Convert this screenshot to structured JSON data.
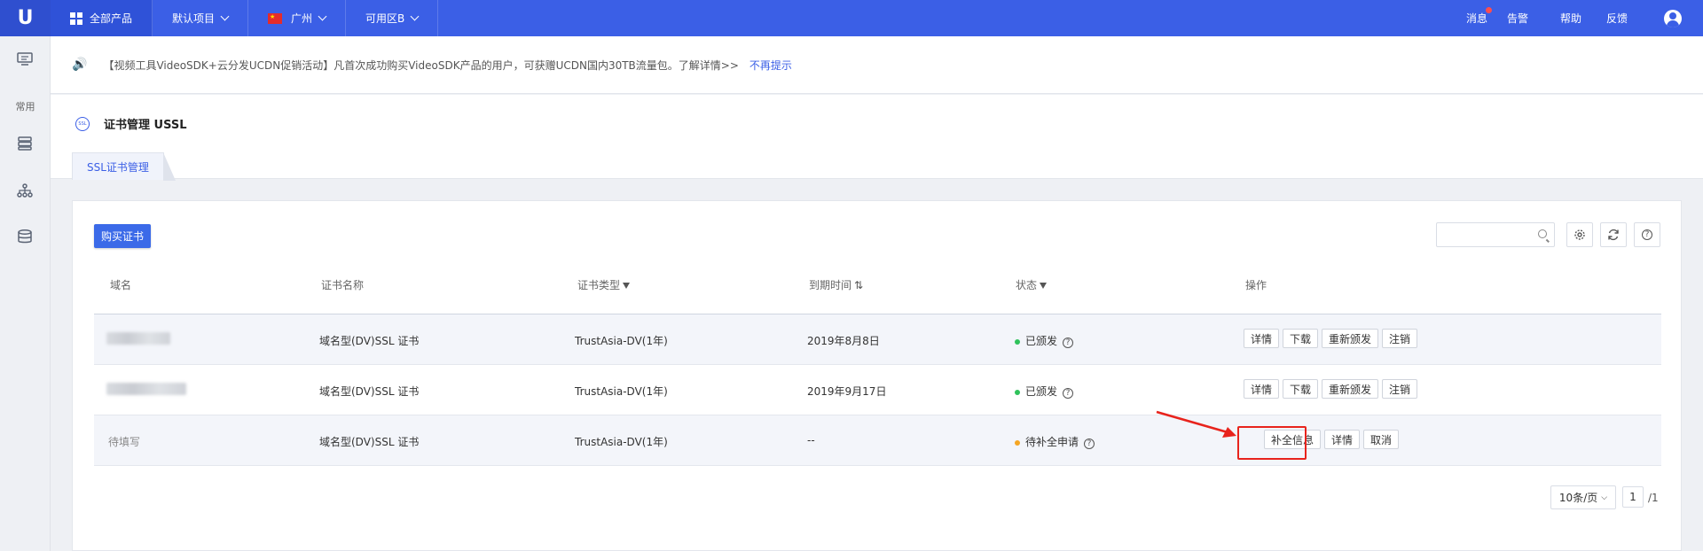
{
  "topbar": {
    "logo": "U",
    "nav": [
      {
        "label": "全部产品"
      },
      {
        "label": "默认项目"
      },
      {
        "label": "广州"
      },
      {
        "label": "可用区B"
      }
    ],
    "right": [
      "消息",
      "告警",
      "帮助",
      "反馈"
    ]
  },
  "sidebar": {
    "label": "常用",
    "icons": [
      "monitor-icon",
      "list-icon",
      "network-icon",
      "database-icon"
    ]
  },
  "notice": {
    "text": "【视频工具VideoSDK+云分发UCDN促销活动】凡首次成功购买VideoSDK产品的用户，可获赠UCDN国内30TB流量包。了解详情>>",
    "dismiss": "不再提示"
  },
  "page": {
    "icon_text": "SSL",
    "title": "证书管理 USSL",
    "tab": "SSL证书管理"
  },
  "toolbar": {
    "buy_label": "购买证书",
    "search_placeholder": ""
  },
  "table": {
    "headers": [
      "域名",
      "证书名称",
      "证书类型",
      "到期时间",
      "状态",
      "操作"
    ],
    "rows": [
      {
        "domain": "",
        "name": "域名型(DV)SSL 证书",
        "type": "TrustAsia-DV(1年)",
        "expire": "2019年8月8日",
        "status": "已颁发",
        "status_color": "#2fc25b",
        "ops": [
          "详情",
          "下载",
          "重新颁发",
          "注销"
        ]
      },
      {
        "domain": "",
        "name": "域名型(DV)SSL 证书",
        "type": "TrustAsia-DV(1年)",
        "expire": "2019年9月17日",
        "status": "已颁发",
        "status_color": "#2fc25b",
        "ops": [
          "详情",
          "下载",
          "重新颁发",
          "注销"
        ]
      },
      {
        "domain": "待填写",
        "name": "域名型(DV)SSL 证书",
        "type": "TrustAsia-DV(1年)",
        "expire": "--",
        "status": "待补全申请",
        "status_color": "#f5a623",
        "ops": [
          "补全信息",
          "详情",
          "取消"
        ]
      }
    ]
  },
  "pagination": {
    "page_size": "10条/页",
    "current": "1",
    "total": "/1"
  },
  "colors": {
    "accent": "#3b5fe6",
    "annotation": "#e8231c"
  }
}
